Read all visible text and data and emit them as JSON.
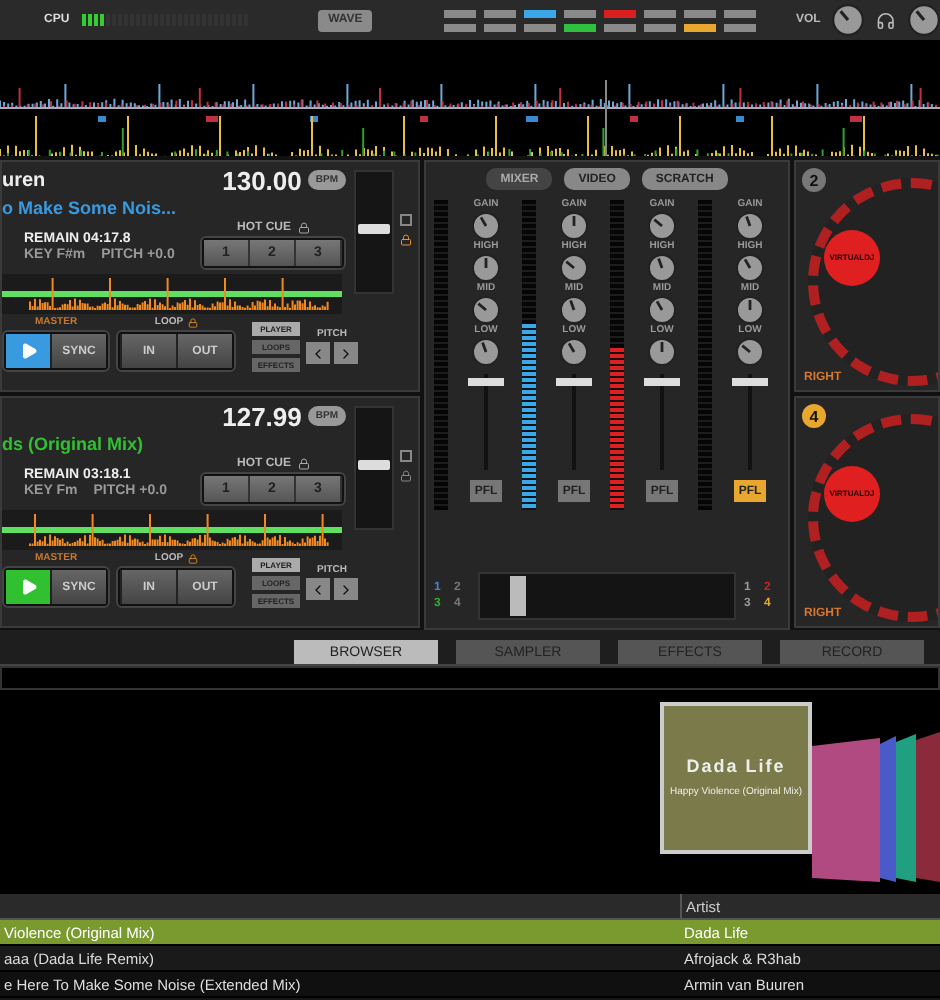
{
  "top_bar": {
    "cpu_label": "CPU",
    "cpu_meter": {
      "level": 0.14
    },
    "wave_button": "WAVE",
    "deck_selectors": [
      {
        "color": "#8a8a8a"
      },
      {
        "color": "#8a8a8a"
      },
      {
        "color": "#3aa8e8"
      },
      {
        "color": "#8a8a8a"
      },
      {
        "color": "#d82020"
      },
      {
        "color": "#8a8a8a"
      },
      {
        "color": "#8a8a8a"
      },
      {
        "color": "#8a8a8a"
      },
      {
        "color": "#8a8a8a"
      },
      {
        "color": "#8a8a8a"
      },
      {
        "color": "#8a8a8a"
      },
      {
        "color": "#30c040"
      },
      {
        "color": "#8a8a8a"
      },
      {
        "color": "#8a8a8a"
      },
      {
        "color": "#e8a830"
      },
      {
        "color": "#8a8a8a"
      }
    ],
    "vol_label": "VOL"
  },
  "decks": [
    {
      "artist": "uren",
      "title": "o Make Some Nois...",
      "color": "#3a9ae0",
      "bpm": "130.00",
      "bpm_unit": "BPM",
      "hot_cue_label": "HOT CUE",
      "hot_cues": [
        "1",
        "2",
        "3"
      ],
      "remain": "REMAIN 04:17.8",
      "key": "KEY F#m",
      "pitch": "PITCH +0.0",
      "master_label": "MASTER",
      "sync": "SYNC",
      "loop_label": "LOOP",
      "loop_buttons": [
        "IN",
        "OUT"
      ],
      "panels": [
        {
          "label": "PLAYER",
          "selected": true
        },
        {
          "label": "LOOPS",
          "selected": false
        },
        {
          "label": "EFFECTS",
          "selected": false
        }
      ],
      "pitch_label": "PITCH",
      "pitch_slider": {
        "level": 0.55
      }
    },
    {
      "title": "ds (Original Mix)",
      "color": "#30c030",
      "bpm": "127.99",
      "bpm_unit": "BPM",
      "hot_cue_label": "HOT CUE",
      "hot_cues": [
        "1",
        "2",
        "3"
      ],
      "remain": "REMAIN 03:18.1",
      "key": "KEY Fm",
      "pitch": "PITCH +0.0",
      "master_label": "MASTER",
      "sync": "SYNC",
      "loop_label": "LOOP",
      "loop_buttons": [
        "IN",
        "OUT"
      ],
      "panels": [
        {
          "label": "PLAYER",
          "selected": true
        },
        {
          "label": "LOOPS",
          "selected": false
        },
        {
          "label": "EFFECTS",
          "selected": false
        }
      ],
      "pitch_label": "PITCH",
      "pitch_slider": {
        "level": 0.55
      }
    }
  ],
  "mixer": {
    "tabs": [
      {
        "label": "MIXER",
        "selected": true
      },
      {
        "label": "VIDEO",
        "selected": false
      },
      {
        "label": "SCRATCH",
        "selected": false
      }
    ],
    "channels": [
      {
        "knob_labels": [
          "GAIN",
          "HIGH",
          "MID",
          "LOW"
        ],
        "pfl": {
          "label": "PFL",
          "on": false
        },
        "fader": {
          "level": 0.95
        }
      },
      {
        "knob_labels": [
          "GAIN",
          "HIGH",
          "MID",
          "LOW"
        ],
        "vu": {
          "level": 0.6
        },
        "color": "#3aa8e8",
        "pfl": {
          "label": "PFL",
          "on": false
        },
        "fader": {
          "level": 0.95
        }
      },
      {
        "knob_labels": [
          "GAIN",
          "HIGH",
          "MID",
          "LOW"
        ],
        "vu": {
          "level": 0.52
        },
        "color": "#e02020",
        "pfl": {
          "label": "PFL",
          "on": false
        },
        "fader": {
          "level": 0.95
        }
      },
      {
        "knob_labels": [
          "GAIN",
          "HIGH",
          "MID",
          "LOW"
        ],
        "pfl": {
          "label": "PFL",
          "on": true
        },
        "fader": {
          "level": 0.95
        }
      }
    ],
    "assign_left": [
      {
        "label": "1",
        "color": "#3a8ad0"
      },
      {
        "label": "2",
        "color": "#777777"
      },
      {
        "label": "3",
        "color": "#30b030"
      },
      {
        "label": "4",
        "color": "#777777"
      }
    ],
    "crossfader": {
      "level": 0.12
    },
    "assign_right": [
      {
        "label": "1",
        "color": "#999999"
      },
      {
        "label": "2",
        "color": "#d02020"
      },
      {
        "label": "3",
        "color": "#999999"
      },
      {
        "label": "4",
        "color": "#e8a830"
      }
    ]
  },
  "turntables": [
    {
      "number": "2",
      "color": "#777777",
      "logo": "VIRTUALDJ",
      "side": "RIGHT"
    },
    {
      "number": "4",
      "color": "#e8a830",
      "logo": "VIRTUALDJ",
      "side": "RIGHT"
    }
  ],
  "browser": {
    "tabs": [
      {
        "label": "BROWSER",
        "selected": true
      },
      {
        "label": "SAMPLER",
        "selected": false
      },
      {
        "label": "EFFECTS",
        "selected": false
      },
      {
        "label": "RECORD",
        "selected": false
      }
    ],
    "cover": {
      "artist": "Dada Life",
      "title": "Happy Violence (Original Mix)"
    },
    "other_covers": [
      {
        "color": "#b04a80"
      },
      {
        "color": "#4a5ac8"
      },
      {
        "color": "#20a080"
      },
      {
        "color": "#8a2a3a"
      }
    ],
    "table": {
      "artist_heading": "Artist",
      "rows": [
        {
          "title": "Violence (Original Mix)",
          "artist": "Dada Life",
          "selected": true
        },
        {
          "title": "aaa (Dada Life Remix)",
          "artist": "Afrojack & R3hab",
          "selected": false
        },
        {
          "title": "e Here To Make Some Noise (Extended Mix)",
          "artist": "Armin van Buuren",
          "selected": false
        }
      ]
    }
  }
}
